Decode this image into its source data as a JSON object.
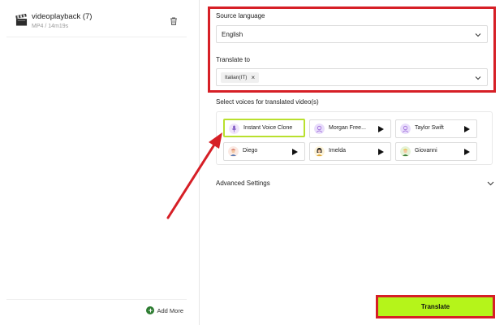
{
  "file": {
    "name": "videoplayback (7)",
    "meta": "MP4 / 14m19s"
  },
  "left": {
    "add_more_label": "Add More"
  },
  "source_language": {
    "label": "Source language",
    "value": "English"
  },
  "translate_to": {
    "label": "Translate to",
    "tags": [
      "Italian(IT)"
    ]
  },
  "voices": {
    "label": "Select voices for translated video(s)",
    "items": [
      {
        "name": "Instant Voice Clone",
        "selected": true
      },
      {
        "name": "Morgan Free...",
        "selected": false
      },
      {
        "name": "Taylor Swift",
        "selected": false
      },
      {
        "name": "Diego",
        "selected": false
      },
      {
        "name": "Imelda",
        "selected": false
      },
      {
        "name": "Giovanni",
        "selected": false
      }
    ]
  },
  "advanced": {
    "label": "Advanced Settings"
  },
  "actions": {
    "translate_label": "Translate"
  },
  "colors": {
    "accent_green": "#b5f41a",
    "highlight_red": "#d61f26",
    "selected_border": "#b9e02e"
  },
  "icons": {
    "file": "clapperboard-icon",
    "delete": "trash-icon",
    "add": "plus-circle-icon",
    "dropdown": "chevron-down-icon",
    "remove_tag": "close-icon",
    "play": "play-icon"
  }
}
